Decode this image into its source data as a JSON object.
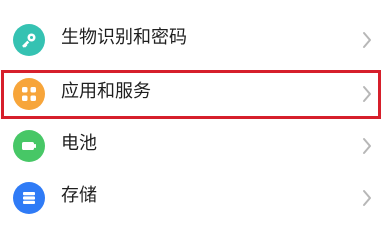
{
  "settings": {
    "items": [
      {
        "label": "生物识别和密码",
        "icon": "key-icon",
        "icon_color": "#35c2b2"
      },
      {
        "label": "应用和服务",
        "icon": "apps-grid-icon",
        "icon_color": "#f7a53a"
      },
      {
        "label": "电池",
        "icon": "battery-icon",
        "icon_color": "#47c766"
      },
      {
        "label": "存储",
        "icon": "storage-icon",
        "icon_color": "#2f7bf6"
      }
    ],
    "highlighted_item": "应用和服务",
    "highlight_color": "#d61f2b"
  }
}
